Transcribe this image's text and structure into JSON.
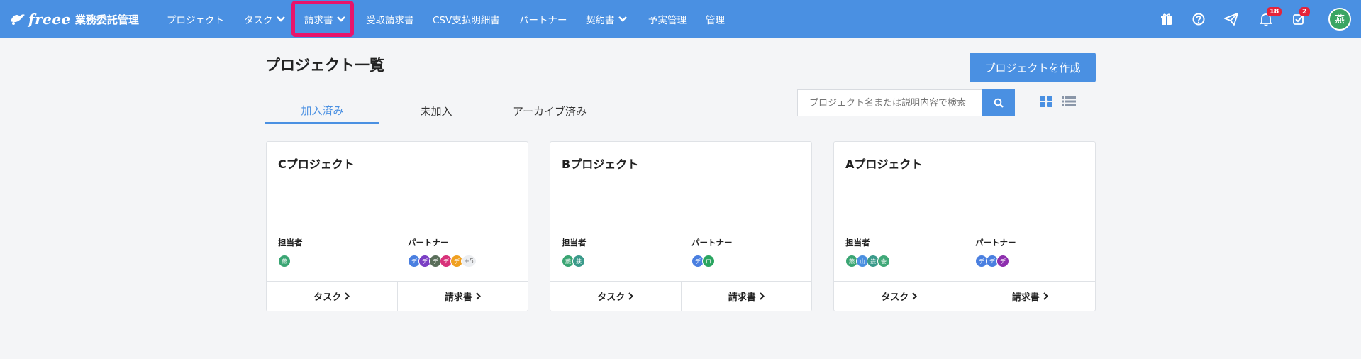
{
  "brand": {
    "logo": "freee",
    "product": "業務委託管理"
  },
  "nav": [
    {
      "label": "プロジェクト",
      "dropdown": false
    },
    {
      "label": "タスク",
      "dropdown": true
    },
    {
      "label": "請求書",
      "dropdown": true
    },
    {
      "label": "受取請求書",
      "dropdown": false
    },
    {
      "label": "CSV支払明細書",
      "dropdown": false
    },
    {
      "label": "パートナー",
      "dropdown": false
    },
    {
      "label": "契約書",
      "dropdown": true
    },
    {
      "label": "予実管理",
      "dropdown": false
    },
    {
      "label": "管理",
      "dropdown": false
    }
  ],
  "top_icons": {
    "gift": "gift-icon",
    "help": "help-icon",
    "send": "paper-plane-icon",
    "notifications": {
      "icon": "bell-icon",
      "count": "18"
    },
    "tasks": {
      "icon": "checkbox-icon",
      "count": "2"
    },
    "avatar": "燕"
  },
  "page": {
    "title": "プロジェクト一覧",
    "create_button": "プロジェクトを作成",
    "tabs": [
      "加入済み",
      "未加入",
      "アーカイブ済み"
    ],
    "active_tab": 0,
    "search_placeholder": "プロジェクト名または説明内容で検索"
  },
  "cards": [
    {
      "title": "Cプロジェクト",
      "owner_label": "担当者",
      "partner_label": "パートナー",
      "owners": [
        {
          "text": "燕",
          "color": "#3aa573"
        }
      ],
      "partners": [
        {
          "text": "デ",
          "color": "#4a7fe0"
        },
        {
          "text": "デ",
          "color": "#7b3fc4"
        },
        {
          "text": "デ",
          "color": "#5a6e5a"
        },
        {
          "text": "デ",
          "color": "#d8327a"
        },
        {
          "text": "デ",
          "color": "#f0a020"
        }
      ],
      "more": "+5",
      "task_button": "タスク",
      "invoice_button": "請求書"
    },
    {
      "title": "Bプロジェクト",
      "owner_label": "担当者",
      "partner_label": "パートナー",
      "owners": [
        {
          "text": "燕",
          "color": "#3aa573"
        },
        {
          "text": "鉄",
          "color": "#3a9a8a"
        }
      ],
      "partners": [
        {
          "text": "デ",
          "color": "#4a7fe0"
        },
        {
          "text": "ロ",
          "color": "#2aa560"
        }
      ],
      "more": "",
      "task_button": "タスク",
      "invoice_button": "請求書"
    },
    {
      "title": "Aプロジェクト",
      "owner_label": "担当者",
      "partner_label": "パートナー",
      "owners": [
        {
          "text": "燕",
          "color": "#3aa573"
        },
        {
          "text": "山",
          "color": "#4a8fe0"
        },
        {
          "text": "鉄",
          "color": "#3a9a8a"
        },
        {
          "text": "会",
          "color": "#40a878"
        }
      ],
      "partners": [
        {
          "text": "デ",
          "color": "#4a7fe0"
        },
        {
          "text": "デ",
          "color": "#4a7fe0"
        },
        {
          "text": "デ",
          "color": "#8e2fae"
        }
      ],
      "more": "",
      "task_button": "タスク",
      "invoice_button": "請求書"
    }
  ],
  "colors": {
    "primary": "#4a90e2",
    "highlight": "#e8146b",
    "badge": "#e5233a"
  }
}
